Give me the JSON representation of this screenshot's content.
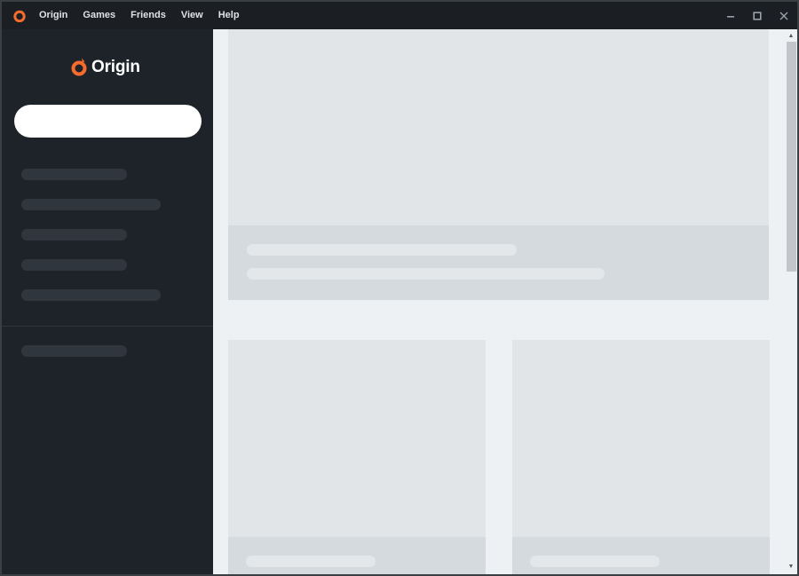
{
  "menu": {
    "items": [
      "Origin",
      "Games",
      "Friends",
      "View",
      "Help"
    ]
  },
  "window": {
    "controls": [
      "minimize-icon",
      "maximize-icon",
      "close-icon"
    ]
  },
  "logo": {
    "text": "Origin",
    "brand_color": "#f56c2d"
  },
  "search": {
    "value": "",
    "placeholder": ""
  },
  "colors": {
    "sidebar": "#1e2329",
    "content": "#eef1f3",
    "card": "#e1e5e8",
    "accent": "#f56c2d"
  }
}
